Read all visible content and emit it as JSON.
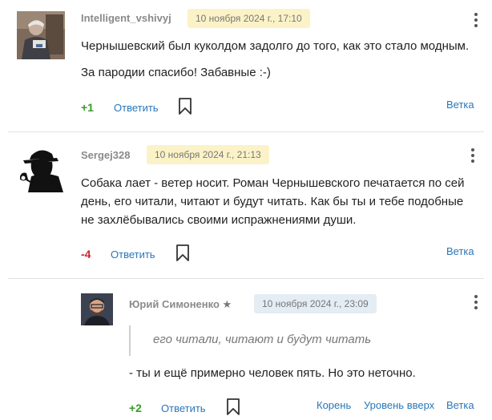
{
  "comments": [
    {
      "author": "Intelligent_vshivyj",
      "date": "10 ноября 2024 г., 17:10",
      "paragraphs": [
        "Чернышевский был куколдом задолго до того, как это стало модным.",
        "За пародии спасибо! Забавные :-)"
      ],
      "score": "+1",
      "reply_label": "Ответить",
      "thread_label": "Ветка"
    },
    {
      "author": "Sergej328",
      "date": "10 ноября 2024 г., 21:13",
      "lines": [
        "Собака лает - ветер носит. Роман Чернышевского печатается по сей",
        "день, его читали, читают и будут читать. Как бы ты и тебе подобные",
        "не захлёбывались своими испражнениями души."
      ],
      "score": "-4",
      "reply_label": "Ответить",
      "thread_label": "Ветка"
    },
    {
      "author": "Юрий Симоненко",
      "author_star": "★",
      "date": "10 ноября 2024 г., 23:09",
      "quote": "его читали, читают и будут читать",
      "text": "- ты и ещё примерно человек пять. Но это неточно.",
      "score": "+2",
      "reply_label": "Ответить",
      "root_label": "Корень",
      "up_label": "Уровень вверх",
      "thread_label": "Ветка"
    }
  ],
  "colors": {
    "positive": "#3a9a2a",
    "negative": "#d0242b",
    "link": "#2a76b9",
    "date_highlight": "#fbf3c7",
    "date_reply": "#e4ecf4"
  },
  "icons": {
    "menu": "kebab-icon",
    "bookmark": "bookmark-icon"
  }
}
